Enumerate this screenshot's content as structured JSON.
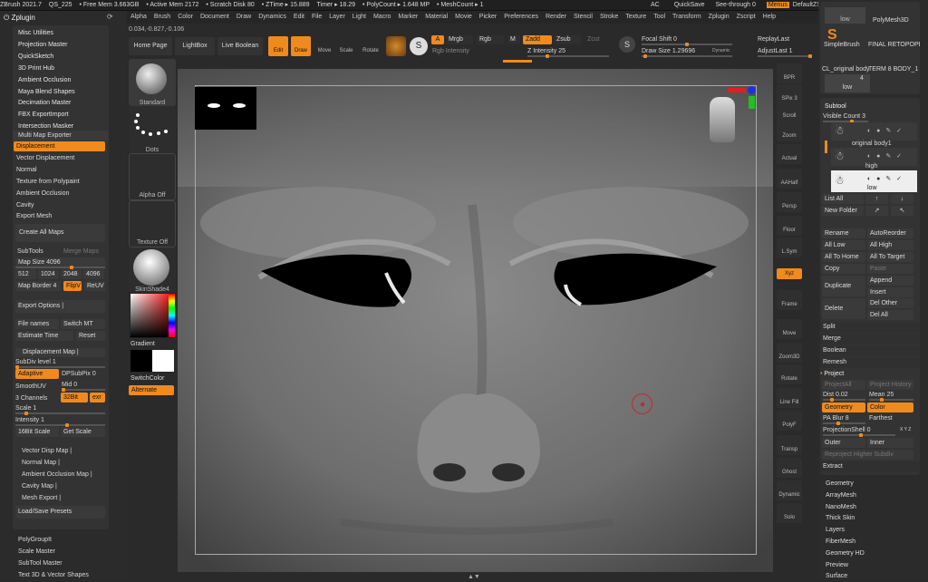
{
  "topbar": {
    "app": "ZBrush 2021.7",
    "project": "QS_225",
    "free_mem": "• Free Mem 3.663GB",
    "active_mem": "• Active Mem 2172",
    "scratch": "• Scratch Disk 80",
    "ztime": "• ZTime ▸ 15.889",
    "timer": "Timer ▸ 18.29",
    "polycount": "• PolyCount ▸ 1.648 MP",
    "meshcount": "• MeshCount ▸ 1",
    "ac": "AC",
    "quicksave": "QuickSave",
    "seethrough": "See-through  0",
    "menus": "Menus",
    "script": "DefaultZScript"
  },
  "menu": [
    "Alpha",
    "Brush",
    "Color",
    "Document",
    "Draw",
    "Dynamics",
    "Edit",
    "File",
    "Layer",
    "Light",
    "Macro",
    "Marker",
    "Material",
    "Movie",
    "Picker",
    "Preferences",
    "Render",
    "Stencil",
    "Stroke",
    "Texture",
    "Tool",
    "Transform",
    "Zplugin",
    "Zscript",
    "Help"
  ],
  "coords": "0.034,-0.827,-0.106",
  "toolbar": {
    "home": "Home Page",
    "lightbox": "LightBox",
    "liveboolean": "Live Boolean",
    "edit": "Edit",
    "draw": "Draw",
    "move": "Move",
    "scale": "Scale",
    "rotate": "Rotate",
    "a": "A",
    "mrgb": "Mrgb",
    "rgb": "Rgb",
    "m": "M",
    "zadd": "Zadd",
    "zsub": "Zsub",
    "zcut": "Zcut",
    "rgb_intensity": "Rgb Intensity",
    "z_intensity": "Z Intensity 25",
    "focal_shift": "Focal Shift 0",
    "draw_size": "Draw Size 1.29696",
    "dynamic": "Dynamic",
    "replay_last": "ReplayLast",
    "adjust_last": "AdjustLast 1"
  },
  "left_panel": {
    "title": "Zplugin",
    "top_items": [
      "Misc Utilities",
      "Projection Master",
      "QuickSketch",
      "3D Print Hub",
      "Ambient Occlusion",
      "Maya Blend Shapes",
      "Decimation Master",
      "FBX ExportImport",
      "Intersection Masker"
    ],
    "multimap": "Multi Map Exporter",
    "map_list": [
      "Displacement",
      "Vector Displacement",
      "Normal",
      "Texture from Polypaint",
      "Ambient Occlusion",
      "Cavity",
      "Export Mesh"
    ],
    "create_all_maps": "Create All Maps",
    "subtools": "SubTools",
    "merge_maps": "Merge Maps",
    "map_size": "Map Size 4096",
    "sizes": [
      "512",
      "1024",
      "2048",
      "4096"
    ],
    "map_border": "Map Border 4",
    "flipv": "FlipV",
    "reuv": "ReUV",
    "export_options": "Export Options  |",
    "file_names": "File names",
    "switch_mt": "Switch MT",
    "estimate_time": "Estimate Time",
    "reset": "Reset",
    "disp_map": "Displacement Map  |",
    "subdiv": "SubDiv level 1",
    "adaptive": "Adaptive",
    "dpsubpix": "DPSubPix 0",
    "smoothuv": "SmoothUV",
    "mid": "Mid 0",
    "three_channels": "3 Channels",
    "bit32": "32Bit",
    "exr": "exr",
    "scale": "Scale 1",
    "intensity": "Intensity 1",
    "bit16": "16Bit Scale",
    "get_scale": "Get Scale",
    "sub_maps": [
      "Vector Disp Map  |",
      "Normal Map  |",
      "Ambient Occlusion Map  |",
      "Cavity Map  |",
      "Mesh Export  |"
    ],
    "load_save": "Load/Save Presets",
    "bottom_items": [
      "PolyGroupIt",
      "Scale Master",
      "SubTool Master",
      "Text 3D & Vector Shapes"
    ]
  },
  "brush_panel": {
    "standard": "Standard",
    "dots": "Dots",
    "alpha_off": "Alpha Off",
    "texture_off": "Texture Off",
    "material": "SkinShade4",
    "gradient": "Gradient",
    "switch_color": "SwitchColor",
    "alternate": "Alternate"
  },
  "right_tools": [
    "BPR",
    "SPix 3",
    "Scroll",
    "Zoom",
    "Actual",
    "AAHalf",
    "Persp",
    "Floor",
    "L.Sym",
    "Xyz",
    "Frame",
    "Move",
    "Zoom3D",
    "Rotate",
    "Line Fill",
    "PolyF",
    "Transp",
    "Ghost",
    "Dynamic",
    "Solo",
    "Xpose"
  ],
  "subtool_panel": {
    "thumbs": [
      "PolyMesh3D",
      "SimpleBrush",
      "FINAL RETOPOPLY",
      "CL_original body",
      "TERM 8 BODY_1"
    ],
    "low_label": "low",
    "count_label": "4",
    "title": "Subtool",
    "visible_count": "Visible Count 3",
    "st_original": "original body1",
    "st_high": "high",
    "st_low": "low",
    "list_all": "List All",
    "new_folder": "New Folder",
    "rename": "Rename",
    "auto_reorder": "AutoReorder",
    "all_low": "All Low",
    "all_high": "All High",
    "all_to_home": "All To Home",
    "all_to_target": "All To Target",
    "copy": "Copy",
    "paste": "Paste",
    "duplicate": "Duplicate",
    "append": "Append",
    "insert": "Insert",
    "delete": "Delete",
    "del_other": "Del Other",
    "del_all": "Del All",
    "split": "Split",
    "merge": "Merge",
    "boolean": "Boolean",
    "remesh": "Remesh",
    "project": "Project",
    "project_all": "ProjectAll",
    "project_history": "Project History",
    "dist": "Dist 0.02",
    "mean": "Mean 25",
    "geometry": "Geometry",
    "color": "Color",
    "pa_blur": "PA Blur 8",
    "farthest": "Farthest",
    "proj_shell": "ProjectionShell 0",
    "xyz_label": "X Y Z",
    "outer": "Outer",
    "inner": "Inner",
    "reproject": "Reproject Higher Subdiv",
    "extract": "Extract",
    "bottom_items": [
      "Geometry",
      "ArrayMesh",
      "NanoMesh",
      "Thick Skin",
      "Layers",
      "FiberMesh",
      "Geometry HD",
      "Preview",
      "Surface"
    ]
  },
  "colors": {
    "accent": "#f08a1c",
    "bg": "#2a2a2a",
    "panel": "#333333",
    "viewport": "#4b4b4b"
  }
}
